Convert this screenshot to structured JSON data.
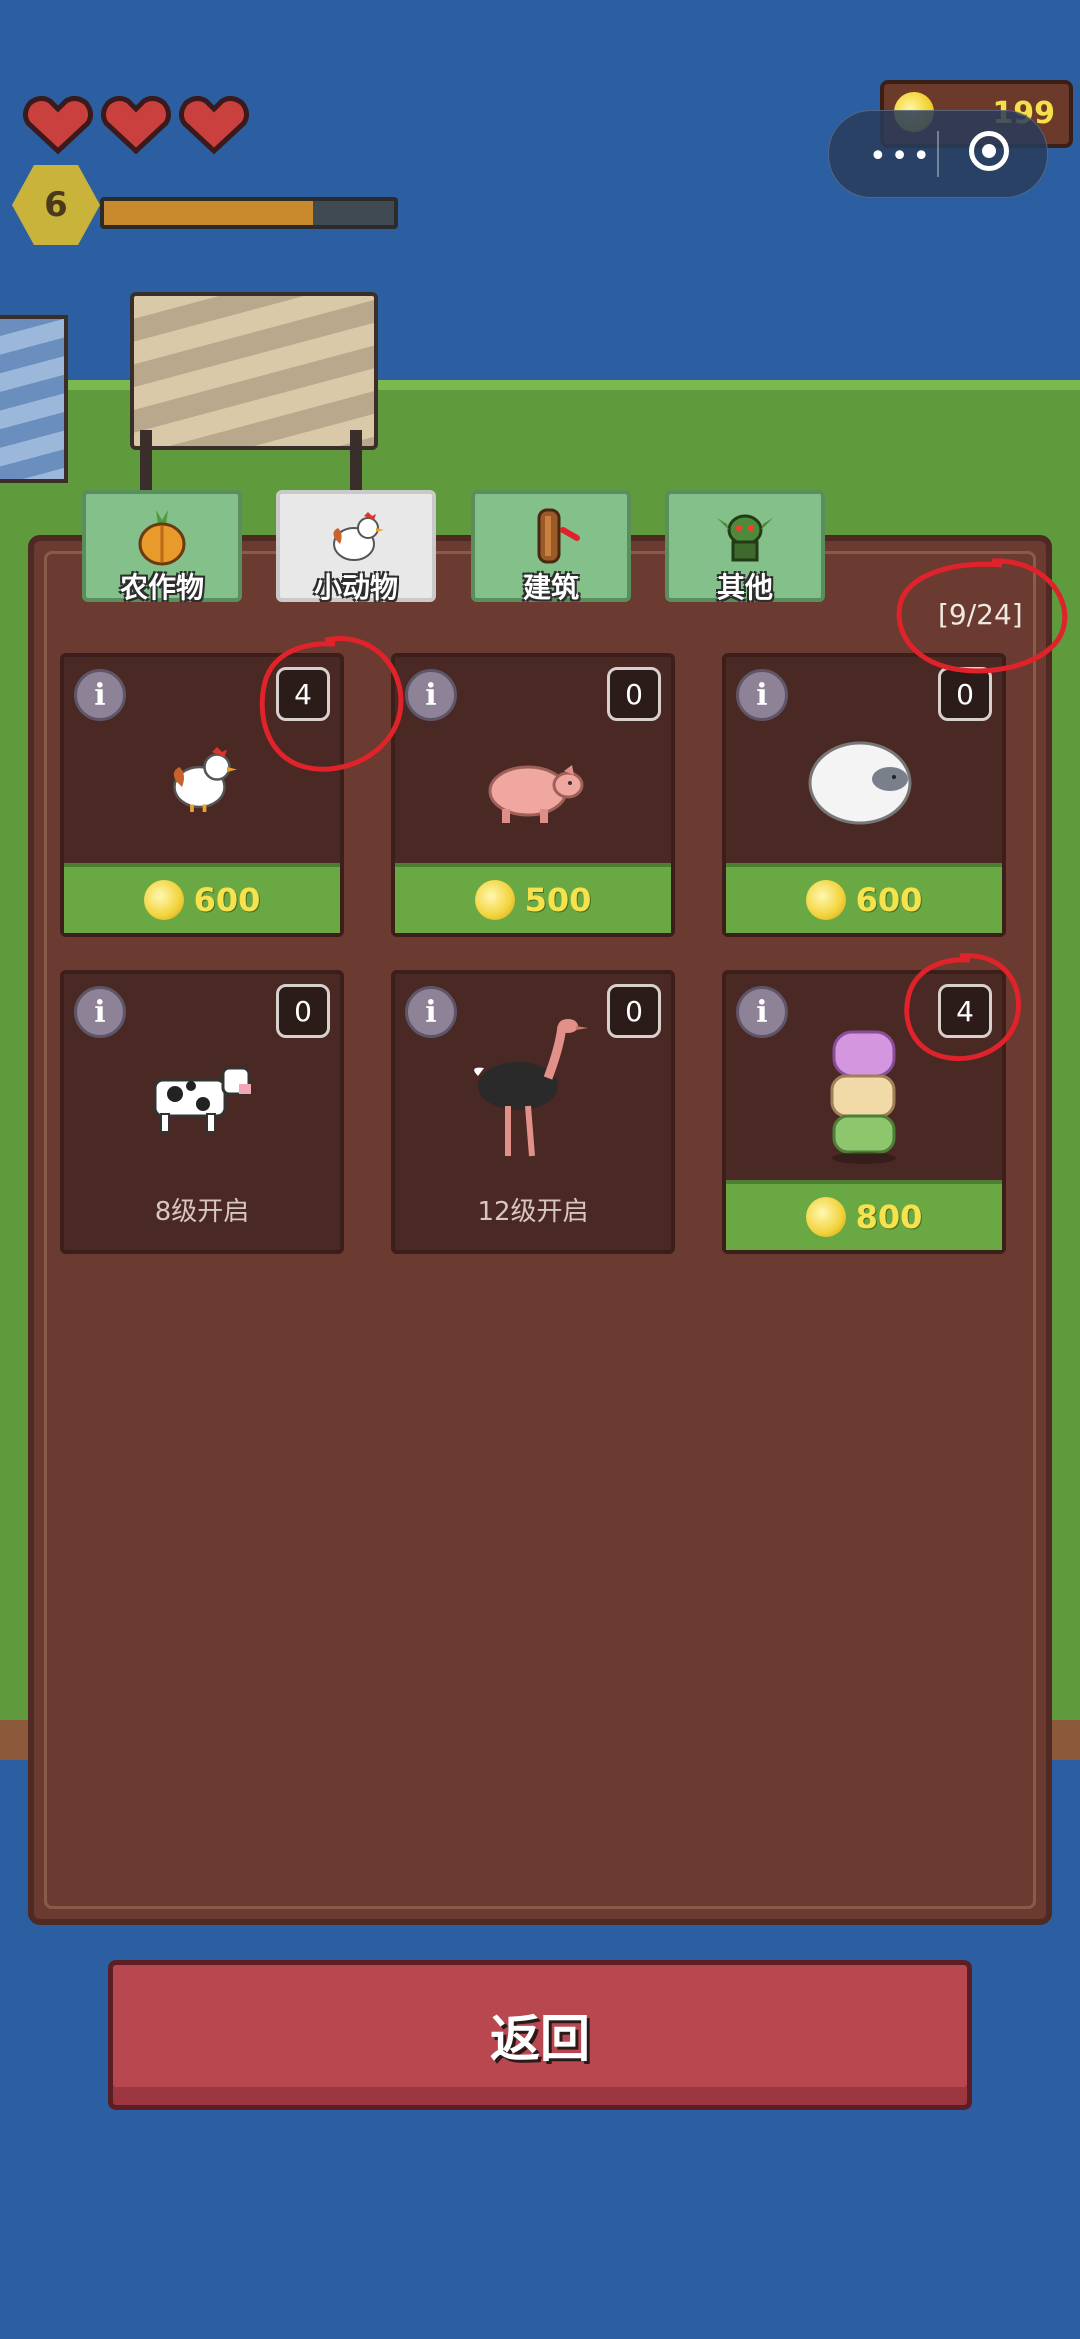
{
  "hud": {
    "hearts": 3,
    "level": "6",
    "xp_fraction": 0.72,
    "coins": "199"
  },
  "tabs": [
    {
      "label": "农作物",
      "icon": "pumpkin-icon",
      "active": false
    },
    {
      "label": "小动物",
      "icon": "chicken-icon",
      "active": true
    },
    {
      "label": "建筑",
      "icon": "log-icon",
      "active": false
    },
    {
      "label": "其他",
      "icon": "goblin-icon",
      "active": false
    }
  ],
  "slot_counter": "[9/24]",
  "cards": [
    {
      "name": "chicken",
      "count": "4",
      "price": "600",
      "locked_text": ""
    },
    {
      "name": "pig",
      "count": "0",
      "price": "500",
      "locked_text": ""
    },
    {
      "name": "sheep",
      "count": "0",
      "price": "600",
      "locked_text": ""
    },
    {
      "name": "cow",
      "count": "0",
      "price": "",
      "locked_text": "8级开启"
    },
    {
      "name": "ostrich",
      "count": "0",
      "price": "",
      "locked_text": "12级开启"
    },
    {
      "name": "slime-stack",
      "count": "4",
      "price": "800",
      "locked_text": ""
    }
  ],
  "info_label": "i",
  "back_button": "返回",
  "capsule_menu": "•••",
  "colors": {
    "annotation": "#e0232b",
    "accent_green": "#6aa844",
    "panel": "#6b3a30"
  }
}
